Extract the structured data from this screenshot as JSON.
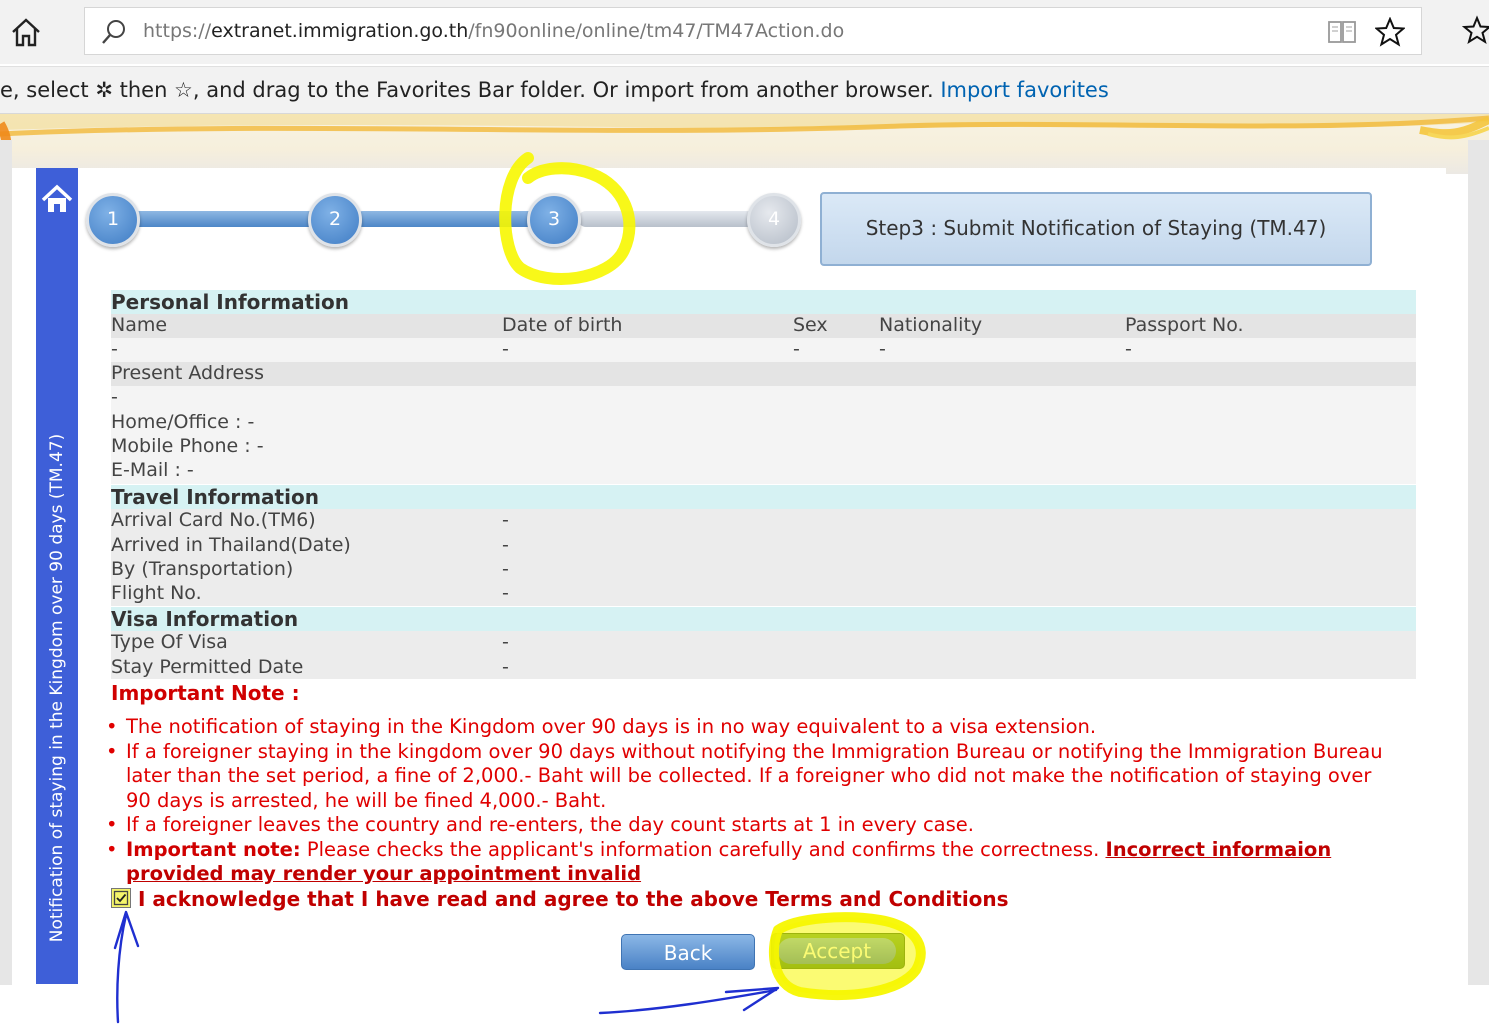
{
  "browser": {
    "url_prefix": "https://",
    "url_host": "extranet.immigration.go.th",
    "url_path": "/fn90online/online/tm47/TM47Action.do",
    "favorites_message": "e, select ✲ then ☆, and drag to the Favorites Bar folder. Or import from another browser.",
    "import_link": "Import favorites"
  },
  "sidebar": {
    "vertical_title": "Notification of staying in the Kingdom over 90 days (TM.47)"
  },
  "steps": {
    "items": [
      {
        "label": "1",
        "state": "done"
      },
      {
        "label": "2",
        "state": "done"
      },
      {
        "label": "3",
        "state": "current"
      },
      {
        "label": "4",
        "state": "todo"
      }
    ],
    "title": "Step3 : Submit Notification of Staying (TM.47)"
  },
  "personal": {
    "heading": "Personal Information",
    "headers": {
      "name": "Name",
      "dob": "Date of birth",
      "sex": "Sex",
      "nationality": "Nationality",
      "passport": "Passport No."
    },
    "values": {
      "name": "-",
      "dob": "-",
      "sex": "-",
      "nationality": "-",
      "passport": "-"
    },
    "address_label": "Present Address",
    "address_value": "-",
    "home_office": "Home/Office : -",
    "mobile": "Mobile Phone : -",
    "email": "E-Mail : -"
  },
  "travel": {
    "heading": "Travel Information",
    "rows": [
      {
        "label": "Arrival Card No.(TM6)",
        "value": "-"
      },
      {
        "label": "Arrived in Thailand(Date)",
        "value": "-"
      },
      {
        "label": "By (Transportation)",
        "value": "-"
      },
      {
        "label": "Flight No.",
        "value": "-"
      }
    ]
  },
  "visa": {
    "heading": "Visa Information",
    "rows": [
      {
        "label": "Type Of Visa",
        "value": "-"
      },
      {
        "label": "Stay Permitted Date",
        "value": "-"
      }
    ]
  },
  "note": {
    "title": "Important Note :",
    "items": [
      "The notification of staying in the Kingdom over 90 days is in no way equivalent to a visa extension.",
      "If a foreigner staying in the kingdom over 90 days without notifying the Immigration Bureau or notifying the Immigration Bureau later than the set period, a fine of 2,000.- Baht will be collected. If a foreigner who did not make the notification of staying over 90 days is arrested, he will be fined 4,000.- Baht.",
      "If a foreigner leaves the country and re-enters, the day count starts at 1 in every case."
    ],
    "last_bold": "Important note:",
    "last_text": " Please checks the applicant's information carefully and confirms the correctness. ",
    "last_link": "Incorrect informaion provided may render your appointment invalid"
  },
  "acknowledge": {
    "checked": true,
    "label": "I acknowledge that I have read and agree to the above Terms and Conditions"
  },
  "buttons": {
    "back": "Back",
    "accept": "Accept"
  },
  "colors": {
    "highlight": "#f7f700",
    "annotation_pen": "#1f2fd0",
    "sidebar": "#3e5fd8",
    "note_red": "#d00000"
  }
}
